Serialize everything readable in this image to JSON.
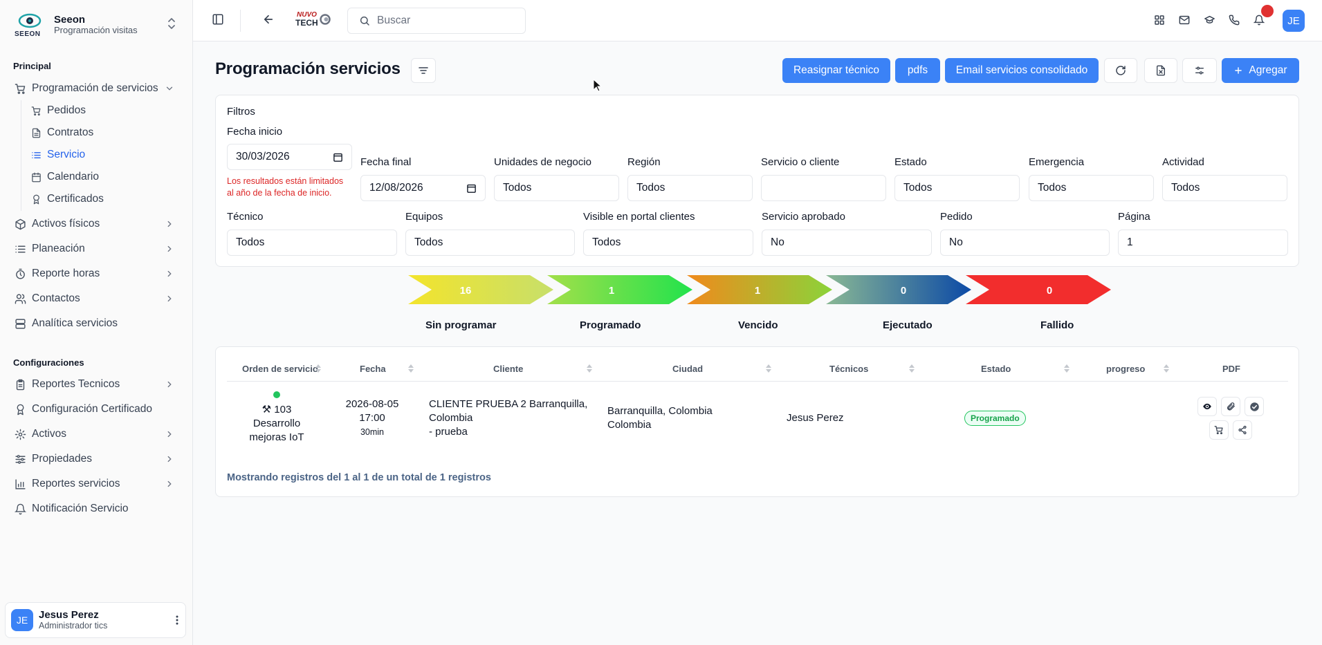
{
  "sidebar": {
    "brand": {
      "logo_text": "SEEON",
      "name": "Seeon",
      "subtitle": "Programación visitas"
    },
    "sections": {
      "principal": "Principal",
      "config": "Configuraciones"
    },
    "main_items": [
      {
        "label": "Programación de servicios",
        "icon": "cart-icon"
      },
      {
        "label": "Activos físicos",
        "icon": "box-icon"
      },
      {
        "label": "Planeación",
        "icon": "list-icon"
      },
      {
        "label": "Reporte horas",
        "icon": "timer-icon"
      },
      {
        "label": "Contactos",
        "icon": "users-icon"
      },
      {
        "label": "Analítica servicios",
        "icon": "server-icon"
      }
    ],
    "sub_items": [
      {
        "label": "Pedidos",
        "icon": "cart-icon"
      },
      {
        "label": "Contratos",
        "icon": "file-icon"
      },
      {
        "label": "Servicio",
        "icon": "list-icon"
      },
      {
        "label": "Calendario",
        "icon": "calendar-icon"
      },
      {
        "label": "Certificados",
        "icon": "award-icon"
      }
    ],
    "config_items": [
      {
        "label": "Reportes Tecnicos",
        "icon": "clipboard-icon"
      },
      {
        "label": "Configuración Certificado",
        "icon": "award-icon"
      },
      {
        "label": "Activos",
        "icon": "gear-icon"
      },
      {
        "label": "Propiedades",
        "icon": "sliders-icon"
      },
      {
        "label": "Reportes servicios",
        "icon": "chart-icon"
      },
      {
        "label": "Notificación Servicio",
        "icon": "bell-icon"
      }
    ],
    "user": {
      "initials": "JE",
      "name": "Jesus Perez",
      "role": "Administrador tics"
    }
  },
  "topbar": {
    "logo_text_1": "NUVO",
    "logo_text_2": "TECH",
    "search_placeholder": "Buscar",
    "avatar_initials": "JE"
  },
  "header": {
    "title": "Programación servicios",
    "buttons": {
      "reassign": "Reasignar técnico",
      "pdfs": "pdfs",
      "email": "Email servicios consolidado",
      "add": "Agregar"
    }
  },
  "filters": {
    "title": "Filtros",
    "fecha_inicio": {
      "label": "Fecha inicio",
      "value": "30/03/2026"
    },
    "warning": "Los resultados están limitados al año de la fecha de inicio.",
    "fecha_final": {
      "label": "Fecha final",
      "value": "12/08/2026"
    },
    "unidades": {
      "label": "Unidades de negocio",
      "value": "Todos"
    },
    "region": {
      "label": "Región",
      "value": "Todos"
    },
    "servicio_cliente": {
      "label": "Servicio o cliente",
      "value": ""
    },
    "estado": {
      "label": "Estado",
      "value": "Todos"
    },
    "emergencia": {
      "label": "Emergencia",
      "value": "Todos"
    },
    "actividad": {
      "label": "Actividad",
      "value": "Todos"
    },
    "tecnico": {
      "label": "Técnico",
      "value": "Todos"
    },
    "equipos": {
      "label": "Equipos",
      "value": "Todos"
    },
    "visible": {
      "label": "Visible en portal clientes",
      "value": "Todos"
    },
    "aprobado": {
      "label": "Servicio aprobado",
      "value": "No"
    },
    "pedido": {
      "label": "Pedido",
      "value": "No"
    },
    "pagina": {
      "label": "Página",
      "value": "1"
    }
  },
  "status_counts": [
    {
      "label": "Sin programar",
      "count": "16",
      "colors": [
        "#f3e42c",
        "#c7df6a"
      ]
    },
    {
      "label": "Programado",
      "count": "1",
      "colors": [
        "#a3df4a",
        "#22e24c"
      ]
    },
    {
      "label": "Vencido",
      "count": "1",
      "colors": [
        "#f08a1c",
        "#8bd33a"
      ]
    },
    {
      "label": "Ejecutado",
      "count": "0",
      "colors": [
        "#8ab894",
        "#0c4aa6"
      ]
    },
    {
      "label": "Fallido",
      "count": "0",
      "colors": [
        "#f22d2d",
        "#f22d2d"
      ]
    }
  ],
  "table": {
    "columns": [
      "Orden de servicio",
      "Fecha",
      "Cliente",
      "Ciudad",
      "Técnicos",
      "Estado",
      "progreso",
      "PDF"
    ],
    "rows": [
      {
        "order_icon": "⚒",
        "order_number": "103",
        "order_desc_1": "Desarrollo",
        "order_desc_2": "mejoras IoT",
        "date": "2026-08-05",
        "time": "17:00",
        "duration": "30min",
        "client_1": "CLIENTE PRUEBA 2 Barranquilla,",
        "client_2": "Colombia",
        "client_3": "- prueba",
        "city_1": "Barranquilla, Colombia",
        "city_2": "Colombia",
        "technician": "Jesus Perez",
        "status": "Programado",
        "progress": ""
      }
    ],
    "footer": "Mostrando registros del 1 al 1 de un total de 1 registros"
  },
  "colors": {
    "accent": "#3b82f6",
    "active_nav": "#2563eb",
    "warning": "#dc2626",
    "status_ok": "#16a34a"
  }
}
